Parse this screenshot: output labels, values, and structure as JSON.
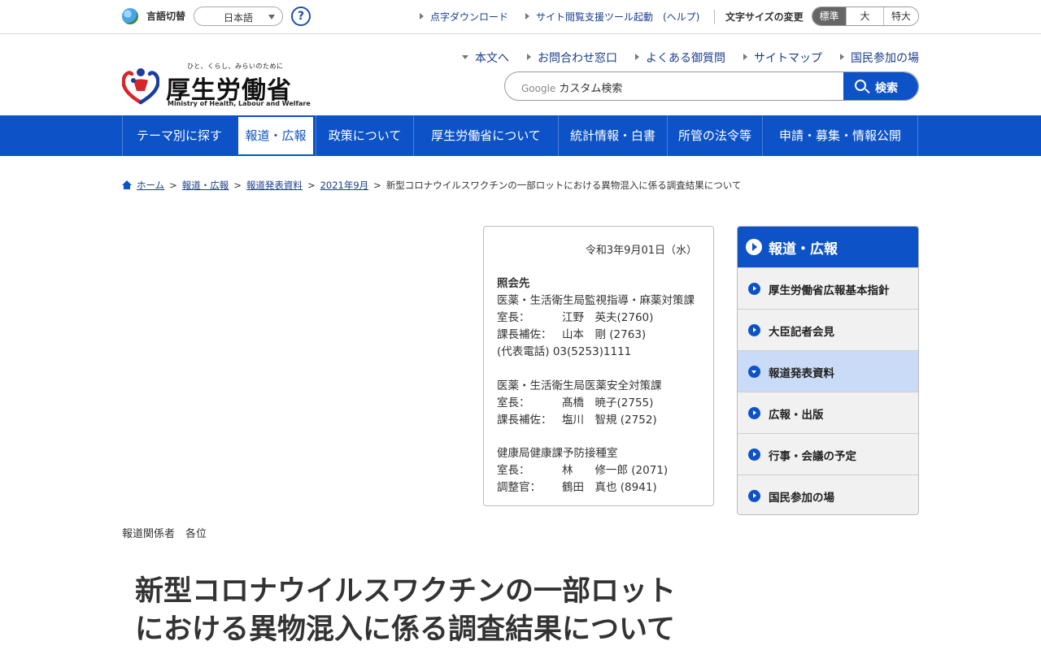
{
  "utility": {
    "lang_label": "言語切替",
    "lang_value": "日本語",
    "help": "?",
    "braille": "点字ダウンロード",
    "assist": "サイト閲覧支援ツール起動　(ヘルプ)",
    "fontsize_label": "文字サイズの変更",
    "sizes": [
      "標準",
      "大",
      "特大"
    ]
  },
  "logo": {
    "tagline": "ひと、くらし、みらいのために",
    "title": "厚生労働省",
    "english": "Ministry of Health, Labour and Welfare"
  },
  "header_links": [
    "本文へ",
    "お問合わせ窓口",
    "よくある御質問",
    "サイトマップ",
    "国民参加の場"
  ],
  "search": {
    "google": "Google",
    "placeholder": "カスタム検索",
    "button": "検索"
  },
  "gnav": [
    "テーマ別に探す",
    "報道・広報",
    "政策について",
    "厚生労働省について",
    "統計情報・白書",
    "所管の法令等",
    "申請・募集・情報公開"
  ],
  "breadcrumb": [
    "ホーム",
    "報道・広報",
    "報道発表資料",
    "2021年9月",
    "新型コロナウイルスワクチンの一部ロットにおける異物混入に係る調査結果について"
  ],
  "contact": {
    "date": "令和3年9月01日（水）",
    "heading": "照会先",
    "dept1": "医薬・生活衛生局監視指導・麻薬対策課",
    "d1_r1_role": "室長：",
    "d1_r1_name": "江野　英夫(2760)",
    "d1_r2_role": "課長補佐：",
    "d1_r2_name": "山本　剛 (2763)",
    "main_phone": "(代表電話) 03(5253)1111",
    "dept2": "医薬・生活衛生局医薬安全対策課",
    "d2_r1_role": "室長：",
    "d2_r1_name": "髙橋　暁子(2755)",
    "d2_r2_role": "課長補佐：",
    "d2_r2_name": "塩川　智規 (2752)",
    "dept3": "健康局健康課予防接種室",
    "d3_r1_role": "室長：",
    "d3_r1_name": "林　　修一郎 (2071)",
    "d3_r2_role": "調整官：",
    "d3_r2_name": "鶴田　真也 (8941)"
  },
  "to_press": "報道関係者　各位",
  "title_line1": "新型コロナウイルスワクチンの一部ロット",
  "title_line2": "における異物混入に係る調査結果について",
  "side": {
    "heading": "報道・広報",
    "items": [
      "厚生労働省広報基本指針",
      "大臣記者会見",
      "報道発表資料",
      "広報・出版",
      "行事・会議の予定",
      "国民参加の場"
    ]
  },
  "colors": {
    "brand_blue": "#0d52c6",
    "link": "#1a3e8c",
    "side_active": "#c9dbf6"
  }
}
